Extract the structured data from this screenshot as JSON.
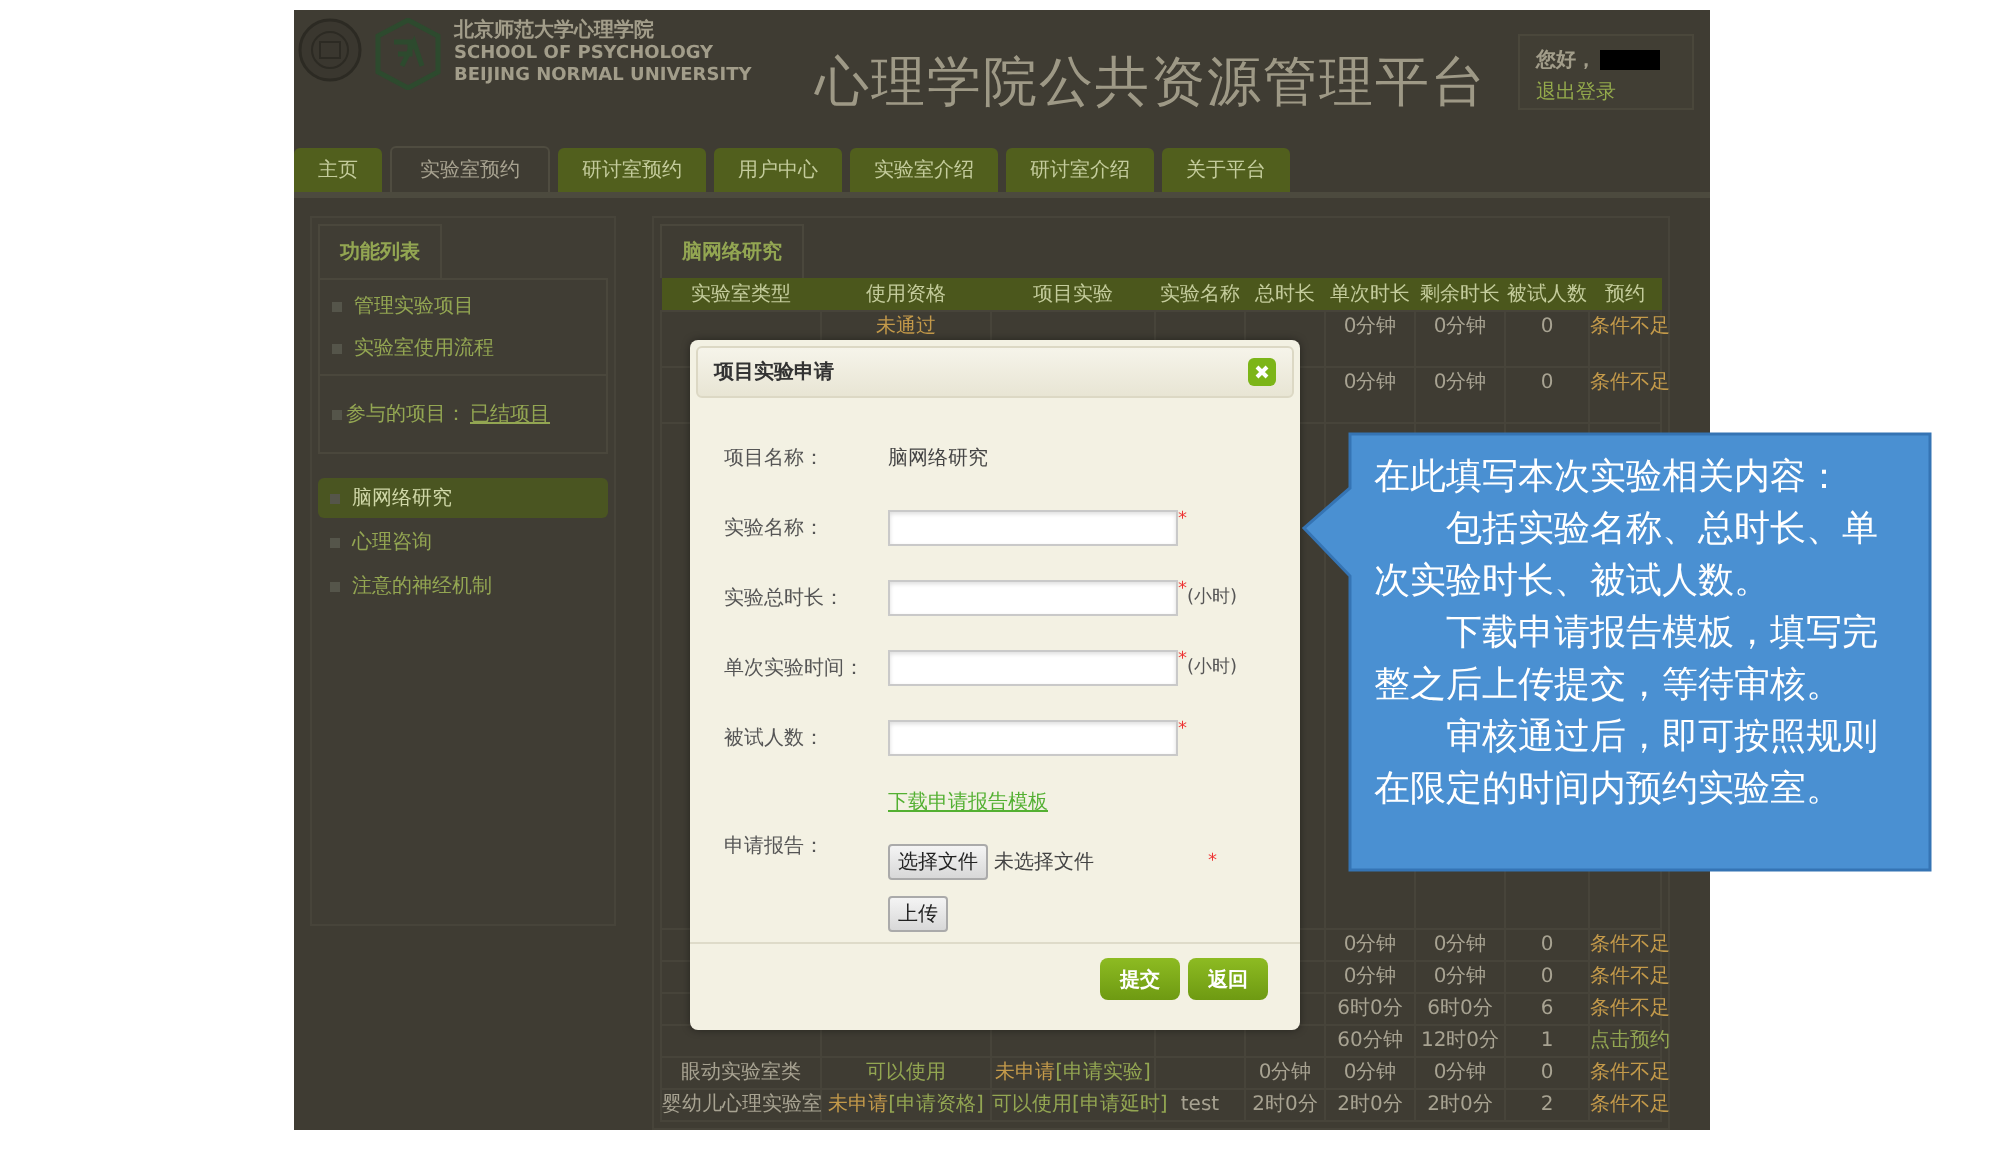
{
  "header": {
    "school_lines": [
      "北京师范大学心理学院",
      "SCHOOL OF PSYCHOLOGY",
      "BEIJING NORMAL UNIVERSITY"
    ],
    "title": "心理学院公共资源管理平台",
    "greeting": "您好，",
    "logout": "退出登录"
  },
  "nav": [
    {
      "label": "主页",
      "selected": false
    },
    {
      "label": "实验室预约",
      "selected": true
    },
    {
      "label": "研讨室预约",
      "selected": false
    },
    {
      "label": "用户中心",
      "selected": false
    },
    {
      "label": "实验室介绍",
      "selected": false
    },
    {
      "label": "研讨室介绍",
      "selected": false
    },
    {
      "label": "关于平台",
      "selected": false
    }
  ],
  "sidebar": {
    "title": "功能列表",
    "links": [
      "管理实验项目",
      "实验室使用流程"
    ],
    "projects_label": "参与的项目：",
    "projects_link": "已结项目",
    "projects": [
      {
        "label": "脑网络研究",
        "selected": true
      },
      {
        "label": "心理咨询",
        "selected": false
      },
      {
        "label": "注意的神经机制",
        "selected": false
      }
    ]
  },
  "table": {
    "tab": "脑网络研究",
    "columns": [
      "实验室类型",
      "使用资格",
      "项目实验",
      "实验名称",
      "总时长",
      "单次时长",
      "剩余时长",
      "被试人数",
      "预约"
    ],
    "rows_top": [
      {
        "qualification": {
          "status": "未通过",
          "approved": false
        },
        "single": "0分钟",
        "remaining": "0分钟",
        "subjects": "0",
        "booking": {
          "text": "条件不足",
          "available": false
        }
      },
      {
        "single": "0分钟",
        "remaining": "0分钟",
        "subjects": "0",
        "booking": {
          "text": "条件不足",
          "available": false
        }
      }
    ],
    "rows_bottom": [
      {
        "single": "0分钟",
        "remaining": "0分钟",
        "subjects": "0",
        "booking": {
          "text": "条件不足",
          "available": false
        }
      },
      {
        "single": "0分钟",
        "remaining": "0分钟",
        "subjects": "0",
        "booking": {
          "text": "条件不足",
          "available": false
        }
      },
      {
        "single": "6时0分",
        "remaining": "6时0分",
        "subjects": "6",
        "booking": {
          "text": "条件不足",
          "available": false
        }
      },
      {
        "single": "60分钟",
        "remaining": "12时0分",
        "subjects": "1",
        "booking": {
          "text": "点击预约",
          "available": true
        }
      },
      {
        "type": "眼动实验室类",
        "qualification": {
          "status": "可以使用",
          "approved": true
        },
        "project": {
          "status": "未申请",
          "action": "[申请实验]",
          "approved": false
        },
        "total": "0分钟",
        "single": "0分钟",
        "remaining": "0分钟",
        "subjects": "0",
        "booking": {
          "text": "条件不足",
          "available": false
        }
      },
      {
        "type": "婴幼儿心理实验室",
        "qualification": {
          "status": "未申请",
          "action": "[申请资格]",
          "approved": false
        },
        "project": {
          "status": "可以使用",
          "action": "[申请延时]",
          "approved": true
        },
        "name": "test",
        "total": "2时0分",
        "single": "2时0分",
        "remaining": "2时0分",
        "subjects": "2",
        "booking": {
          "text": "条件不足",
          "available": false
        }
      }
    ]
  },
  "dialog": {
    "title": "项目实验申请",
    "project_label": "项目名称：",
    "project_value": "脑网络研究",
    "fields": [
      {
        "label": "实验名称：",
        "mark": "*"
      },
      {
        "label": "实验总时长：",
        "mark": "*",
        "unit": "(小时)"
      },
      {
        "label": "单次实验时间：",
        "mark": "*",
        "unit": "(小时)"
      },
      {
        "label": "被试人数：",
        "mark": "*"
      }
    ],
    "template_link": "下载申请报告模板",
    "report_label": "申请报告：",
    "choose_button": "选择文件",
    "file_status": "未选择文件",
    "report_mark": "*",
    "upload_button": "上传",
    "buttons": [
      "提交",
      "返回"
    ]
  },
  "callout": [
    {
      "text": "在此填写本次实验相关内容：",
      "indent": false
    },
    {
      "text": "包括实验名称、总时长、单次实验时长、被试人数。",
      "indent": true
    },
    {
      "text": "下载申请报告模板，填写完整之后上传提交，等待审核。",
      "indent": true
    },
    {
      "text": "审核通过后，即可按照规则在限定的时间内预约实验室。",
      "indent": true
    }
  ]
}
